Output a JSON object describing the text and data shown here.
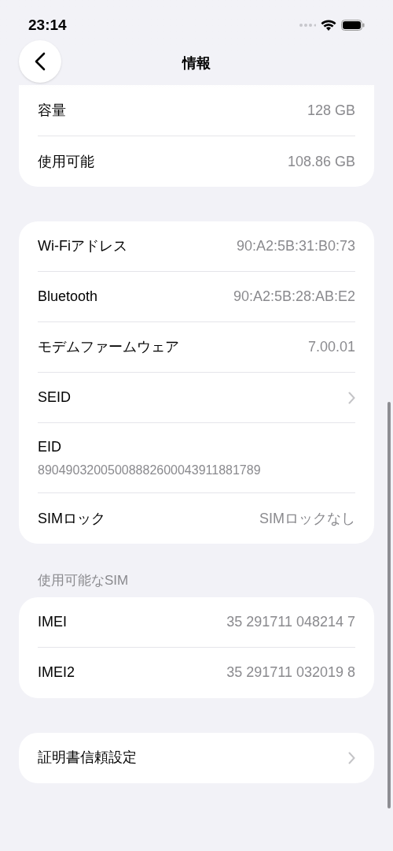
{
  "status_bar": {
    "time": "23:14"
  },
  "nav": {
    "title": "情報"
  },
  "groups": [
    {
      "rows": [
        {
          "kind": "value",
          "label": "容量",
          "value": "128 GB"
        },
        {
          "kind": "value",
          "label": "使用可能",
          "value": "108.86 GB"
        }
      ]
    },
    {
      "rows": [
        {
          "kind": "value",
          "label": "Wi-Fiアドレス",
          "value": "90:A2:5B:31:B0:73"
        },
        {
          "kind": "value",
          "label": "Bluetooth",
          "value": "90:A2:5B:28:AB:E2"
        },
        {
          "kind": "value",
          "label": "モデムファームウェア",
          "value": "7.00.01"
        },
        {
          "kind": "chevron",
          "label": "SEID"
        },
        {
          "kind": "stacked",
          "label": "EID",
          "value": "89049032005008882600043911881789"
        },
        {
          "kind": "value",
          "label": "SIMロック",
          "value": "SIMロックなし"
        }
      ]
    },
    {
      "header": "使用可能なSIM",
      "rows": [
        {
          "kind": "value",
          "label": "IMEI",
          "value": "35 291711 048214 7"
        },
        {
          "kind": "value",
          "label": "IMEI2",
          "value": "35 291711 032019 8"
        }
      ]
    },
    {
      "rows": [
        {
          "kind": "chevron",
          "label": "証明書信頼設定"
        }
      ]
    }
  ]
}
